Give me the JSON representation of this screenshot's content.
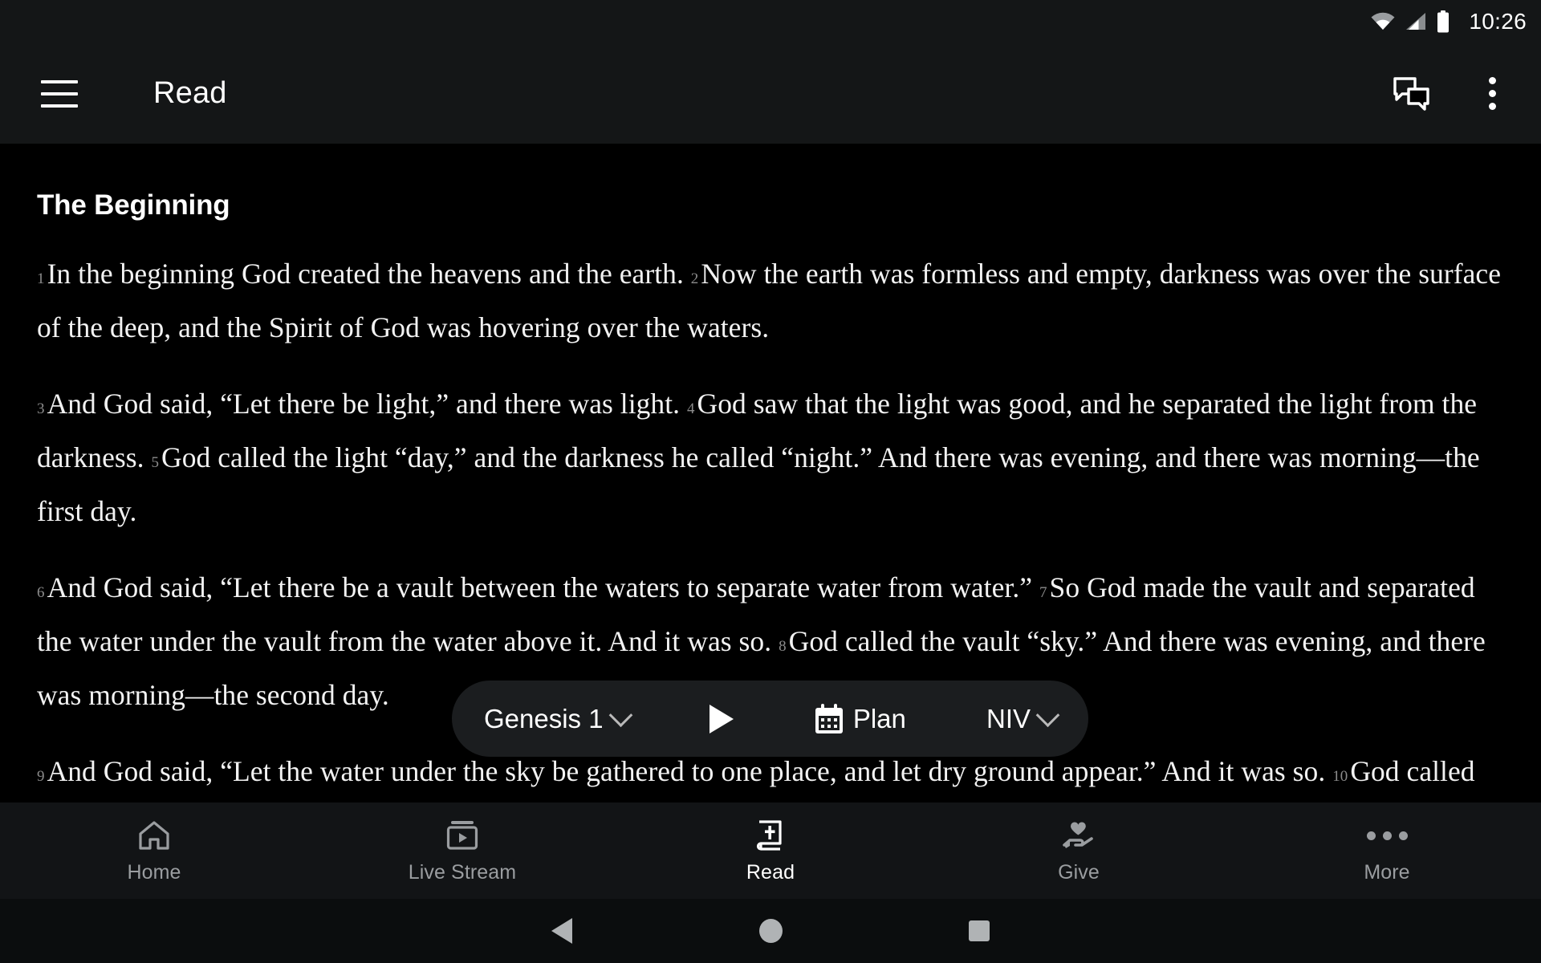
{
  "status_bar": {
    "time": "10:26",
    "icons": [
      "wifi-icon",
      "cellular-signal-icon",
      "battery-icon"
    ]
  },
  "app_bar": {
    "menu_icon": "hamburger-menu-icon",
    "title": "Read",
    "actions": [
      {
        "icon": "chat-bubbles-icon",
        "name": "comments-button"
      },
      {
        "icon": "overflow-menu-icon",
        "name": "more-options-button"
      }
    ]
  },
  "content": {
    "heading": "The Beginning",
    "paragraphs": [
      {
        "verses": [
          {
            "num": "1",
            "text": "In the beginning God created the heavens and the earth."
          },
          {
            "num": "2",
            "text": "Now the earth was formless and empty, darkness was over the surface of the deep, and the Spirit of God was hovering over the waters."
          }
        ]
      },
      {
        "verses": [
          {
            "num": "3",
            "text": "And God said, “Let there be light,” and there was light."
          },
          {
            "num": "4",
            "text": "God saw that the light was good, and he separated the light from the darkness."
          },
          {
            "num": "5",
            "text": "God called the light “day,” and the darkness he called “night.” And there was evening, and there was morning—the first day."
          }
        ]
      },
      {
        "verses": [
          {
            "num": "6",
            "text": "And God said, “Let there be a vault between the waters to separate water from water.”"
          },
          {
            "num": "7",
            "text": "So God made the vault and separated the water under the vault from the water above it. And it was so."
          },
          {
            "num": "8",
            "text": "God called the vault “sky.” And there was evening, and there was morning—the second day."
          }
        ]
      },
      {
        "verses": [
          {
            "num": "9",
            "text": "And God said, “Let the water under the sky be gathered to one place, and let dry ground appear.” And it was so."
          },
          {
            "num": "10",
            "text": "God called the dry ground “land,” and the gathered waters he called “seas.” And God saw that it was good."
          }
        ]
      }
    ]
  },
  "float_bar": {
    "chapter_label": "Genesis 1",
    "chapter_chevron": "chevron-down-icon",
    "play_icon": "play-icon",
    "plan_icon": "calendar-icon",
    "plan_label": "Plan",
    "version_label": "NIV",
    "version_chevron": "chevron-down-icon"
  },
  "bottom_nav": {
    "items": [
      {
        "label": "Home",
        "icon": "home-icon",
        "active": false
      },
      {
        "label": "Live Stream",
        "icon": "live-stream-icon",
        "active": false
      },
      {
        "label": "Read",
        "icon": "bible-book-icon",
        "active": true
      },
      {
        "label": "Give",
        "icon": "hand-heart-icon",
        "active": false
      },
      {
        "label": "More",
        "icon": "ellipsis-icon",
        "active": false
      }
    ]
  },
  "android_nav": {
    "back": "back-triangle-icon",
    "home": "home-circle-icon",
    "recents": "recents-square-icon"
  },
  "colors": {
    "app_bar_bg": "#141617",
    "content_bg": "#000000",
    "bottom_nav_bg": "#121416",
    "float_bar_bg": "#1b1d1f",
    "text_primary": "#ffffff",
    "text_muted": "#9a9da0",
    "verse_number": "#8c8c8c"
  }
}
